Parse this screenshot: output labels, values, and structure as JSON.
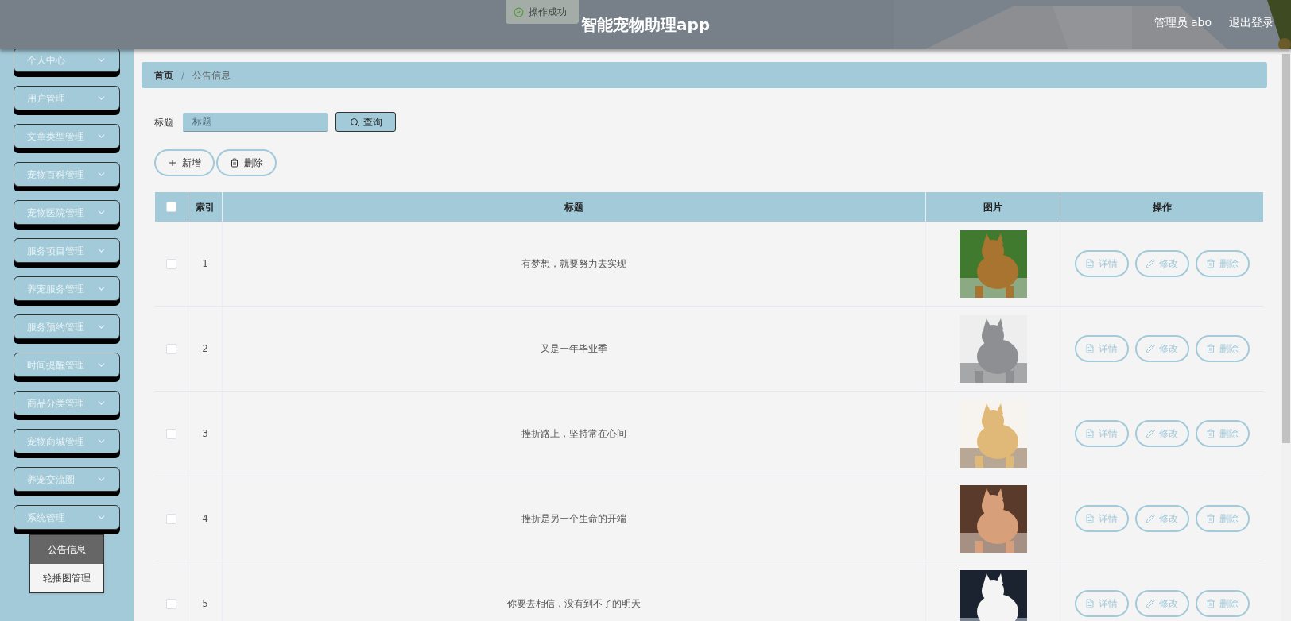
{
  "header": {
    "title": "智能宠物助理app",
    "user": "管理员 abo",
    "logout": "退出登录",
    "background": {
      "kind": "picture"
    }
  },
  "toast": {
    "message": "操作成功"
  },
  "sidebar": {
    "items": [
      {
        "label": "个人中心"
      },
      {
        "label": "用户管理"
      },
      {
        "label": "文章类型管理"
      },
      {
        "label": "宠物百科管理"
      },
      {
        "label": "宠物医院管理"
      },
      {
        "label": "服务项目管理"
      },
      {
        "label": "养宠服务管理"
      },
      {
        "label": "服务预约管理"
      },
      {
        "label": "时间提醒管理"
      },
      {
        "label": "商品分类管理"
      },
      {
        "label": "宠物商城管理"
      },
      {
        "label": "养宠交流圈"
      },
      {
        "label": "系统管理",
        "children": [
          {
            "label": "公告信息",
            "selected": true
          },
          {
            "label": "轮播图管理",
            "selected": false
          }
        ]
      }
    ]
  },
  "breadcrumb": {
    "items": [
      "首页",
      "公告信息"
    ],
    "separator": "/"
  },
  "search": {
    "label": "标题",
    "placeholder": "标题",
    "button": "查询"
  },
  "actions": [
    "新增",
    "删除"
  ],
  "table": {
    "select_all": {
      "checked": false
    },
    "columns": [
      "索引",
      "标题",
      "图片",
      "操作"
    ],
    "rows": [
      {
        "checked": false,
        "index": "1",
        "title": "有梦想，就要努力去实现",
        "image": {
          "kind": "picture"
        },
        "operations": [
          "详情",
          "修改",
          "删除"
        ]
      },
      {
        "checked": false,
        "index": "2",
        "title": "又是一年毕业季",
        "image": {
          "kind": "picture"
        },
        "operations": [
          "详情",
          "修改",
          "删除"
        ]
      },
      {
        "checked": false,
        "index": "3",
        "title": "挫折路上，坚持常在心间",
        "image": {
          "kind": "picture"
        },
        "operations": [
          "详情",
          "修改",
          "删除"
        ]
      },
      {
        "checked": false,
        "index": "4",
        "title": "挫折是另一个生命的开端",
        "image": {
          "kind": "picture"
        },
        "operations": [
          "详情",
          "修改",
          "删除"
        ]
      },
      {
        "checked": false,
        "index": "5",
        "title": "你要去相信，没有到不了的明天",
        "image": {
          "kind": "picture"
        },
        "operations": [
          "详情",
          "修改",
          "删除"
        ]
      }
    ]
  }
}
